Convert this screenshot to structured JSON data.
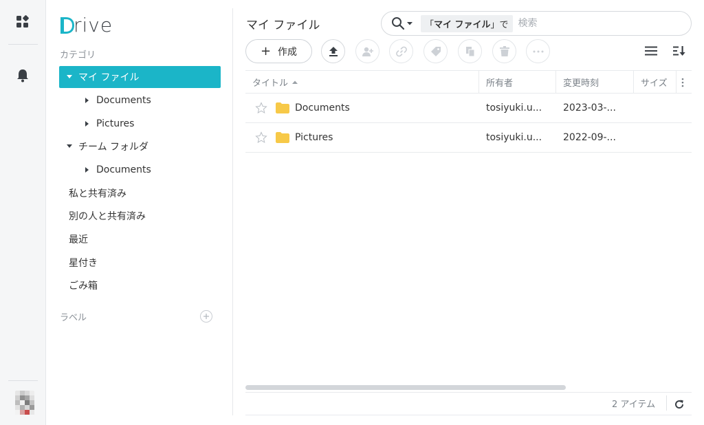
{
  "app": {
    "logo": "Drive"
  },
  "sidebar": {
    "category_label": "カテゴリ",
    "my_files": "マイ ファイル",
    "my_files_children": [
      "Documents",
      "Pictures"
    ],
    "team_folder": "チーム フォルダ",
    "team_folder_children": [
      "Documents"
    ],
    "items": [
      "私と共有済み",
      "別の人と共有済み",
      "最近",
      "星付き",
      "ごみ箱"
    ],
    "labels_label": "ラベル"
  },
  "main": {
    "title": "マイ ファイル",
    "search": {
      "scope_open": "「",
      "scope_name": "マイ ファイル",
      "scope_close": "」で",
      "placeholder": "検索"
    },
    "create_label": "作成"
  },
  "table": {
    "columns": [
      "タイトル",
      "所有者",
      "変更時刻",
      "サイズ"
    ],
    "rows": [
      {
        "title": "Documents",
        "owner": "tosiyuki.u...",
        "modified": "2023-03-..."
      },
      {
        "title": "Pictures",
        "owner": "tosiyuki.u...",
        "modified": "2022-09-..."
      }
    ]
  },
  "footer": {
    "count": "2 アイテム"
  },
  "colors": {
    "accent": "#1bb5c8",
    "folder": "#f7c948"
  }
}
